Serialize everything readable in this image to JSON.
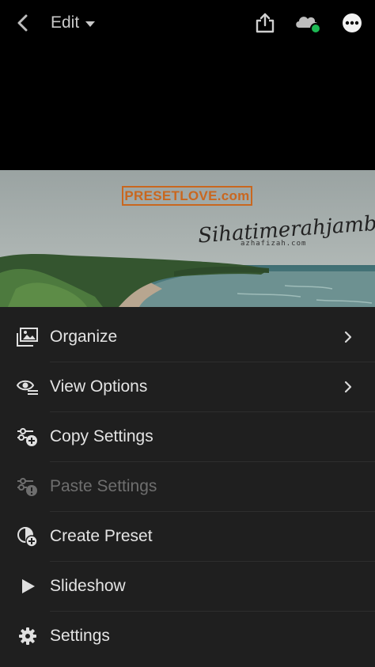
{
  "toolbar": {
    "mode_label": "Edit",
    "status_color": "#1db954"
  },
  "photo": {
    "watermark_brand": "PRESETLOVE.com",
    "signature_text": "Sihatimerahjambu",
    "signature_sub": "azhafizah.com",
    "brand_color": "#c9671f"
  },
  "menu": {
    "items": [
      {
        "label": "Organize",
        "icon": "organize-icon",
        "has_chevron": true,
        "enabled": true
      },
      {
        "label": "View Options",
        "icon": "view-options-icon",
        "has_chevron": true,
        "enabled": true
      },
      {
        "label": "Copy Settings",
        "icon": "copy-settings-icon",
        "has_chevron": false,
        "enabled": true
      },
      {
        "label": "Paste Settings",
        "icon": "paste-settings-icon",
        "has_chevron": false,
        "enabled": false
      },
      {
        "label": "Create Preset",
        "icon": "create-preset-icon",
        "has_chevron": false,
        "enabled": true
      },
      {
        "label": "Slideshow",
        "icon": "slideshow-icon",
        "has_chevron": false,
        "enabled": true
      },
      {
        "label": "Settings",
        "icon": "settings-icon",
        "has_chevron": false,
        "enabled": true
      }
    ]
  }
}
